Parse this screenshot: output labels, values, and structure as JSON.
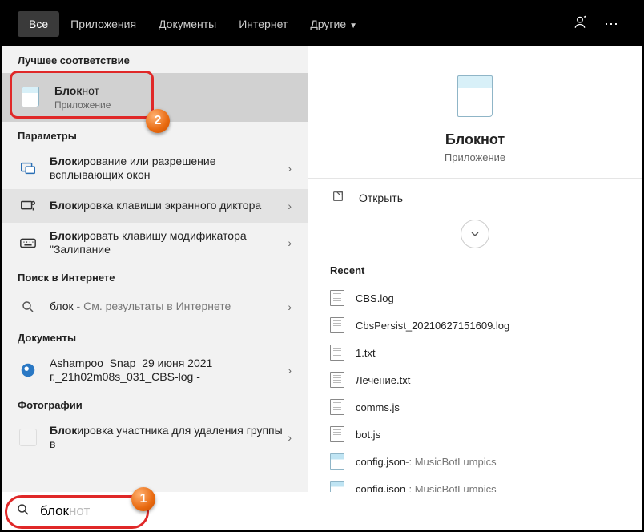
{
  "topbar": {
    "tabs": [
      "Все",
      "Приложения",
      "Документы",
      "Интернет",
      "Другие"
    ],
    "active": 0,
    "feedback_icon": "feedback",
    "more_icon": "⋯"
  },
  "left": {
    "best_match_header": "Лучшее соответствие",
    "best_match": {
      "title_bold": "Блок",
      "title_rest": "нот",
      "sub": "Приложение"
    },
    "params_header": "Параметры",
    "params": [
      {
        "title_bold": "Блок",
        "title_rest": "ирование или разрешение всплывающих окон"
      },
      {
        "title_bold": "Блок",
        "title_rest": "ировка клавиши экранного диктора"
      },
      {
        "title_bold": "Блок",
        "title_rest": "ировать клавишу модификатора \"Залипание"
      }
    ],
    "web_header": "Поиск в Интернете",
    "web": {
      "query": "блок",
      "suffix": " - См. результаты в Интернете"
    },
    "docs_header": "Документы",
    "docs": [
      {
        "title": "Ashampoo_Snap_29 июня 2021 г._21h02m08s_031_CBS-log -"
      }
    ],
    "photos_header": "Фотографии",
    "photos": [
      {
        "title_bold": "Блок",
        "title_rest": "ировка участника для удаления группы в"
      }
    ]
  },
  "right": {
    "title": "Блокнот",
    "sub": "Приложение",
    "open_label": "Открыть",
    "recent_header": "Recent",
    "recent": [
      {
        "name": "CBS.log",
        "type": "doc"
      },
      {
        "name": "CbsPersist_20210627151609.log",
        "type": "doc"
      },
      {
        "name": "1.txt",
        "type": "doc"
      },
      {
        "name": "Лечение.txt",
        "type": "doc"
      },
      {
        "name": "comms.js",
        "type": "doc"
      },
      {
        "name": "bot.js",
        "type": "doc"
      },
      {
        "name": "config.json",
        "suffix": " -: MusicBotLumpics",
        "type": "np"
      },
      {
        "name": "config.json",
        "suffix": " -: MusicBotLumpics",
        "type": "np"
      }
    ]
  },
  "search": {
    "typed": "блок",
    "ghost": "нот"
  },
  "callouts": {
    "one": "1",
    "two": "2"
  }
}
